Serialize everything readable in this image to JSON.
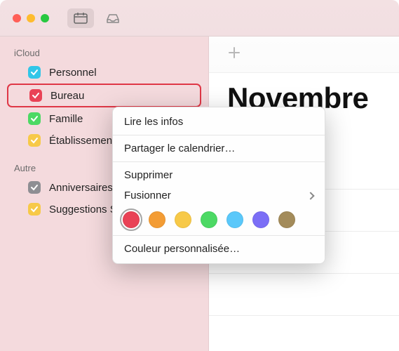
{
  "window": {
    "traffic_lights": [
      "close",
      "minimize",
      "zoom"
    ]
  },
  "toolbar": {
    "calendars_icon": "calendars",
    "inbox_icon": "inbox"
  },
  "sidebar": {
    "sections": [
      {
        "title": "iCloud",
        "items": [
          {
            "label": "Personnel",
            "color": "#31c6e8",
            "checked": true,
            "selected": false
          },
          {
            "label": "Bureau",
            "color": "#e94256",
            "checked": true,
            "selected": true
          },
          {
            "label": "Famille",
            "color": "#4cd964",
            "checked": true,
            "selected": false
          },
          {
            "label": "Établissement scolaire",
            "color": "#f7c948",
            "checked": true,
            "selected": false
          }
        ]
      },
      {
        "title": "Autre",
        "items": [
          {
            "label": "Anniversaires",
            "color": "#8e8e93",
            "checked": true,
            "selected": false
          },
          {
            "label": "Suggestions Siri",
            "color": "#f7c948",
            "checked": true,
            "selected": false
          }
        ]
      }
    ]
  },
  "main": {
    "month_title": "Novembre",
    "add_event": "+"
  },
  "context_menu": {
    "items": [
      {
        "label": "Lire les infos",
        "type": "item"
      },
      {
        "type": "separator"
      },
      {
        "label": "Partager le calendrier…",
        "type": "item"
      },
      {
        "type": "separator"
      },
      {
        "label": "Supprimer",
        "type": "item"
      },
      {
        "label": "Fusionner",
        "type": "submenu"
      }
    ],
    "colors": [
      {
        "hex": "#e94256",
        "name": "red",
        "selected": true
      },
      {
        "hex": "#f39c34",
        "name": "orange",
        "selected": false
      },
      {
        "hex": "#f7c948",
        "name": "yellow",
        "selected": false
      },
      {
        "hex": "#4cd964",
        "name": "green",
        "selected": false
      },
      {
        "hex": "#5ac8fa",
        "name": "blue",
        "selected": false
      },
      {
        "hex": "#7b6ef6",
        "name": "purple",
        "selected": false
      },
      {
        "hex": "#a38b5a",
        "name": "brown",
        "selected": false
      }
    ],
    "custom_color_label": "Couleur personnalisée…"
  }
}
